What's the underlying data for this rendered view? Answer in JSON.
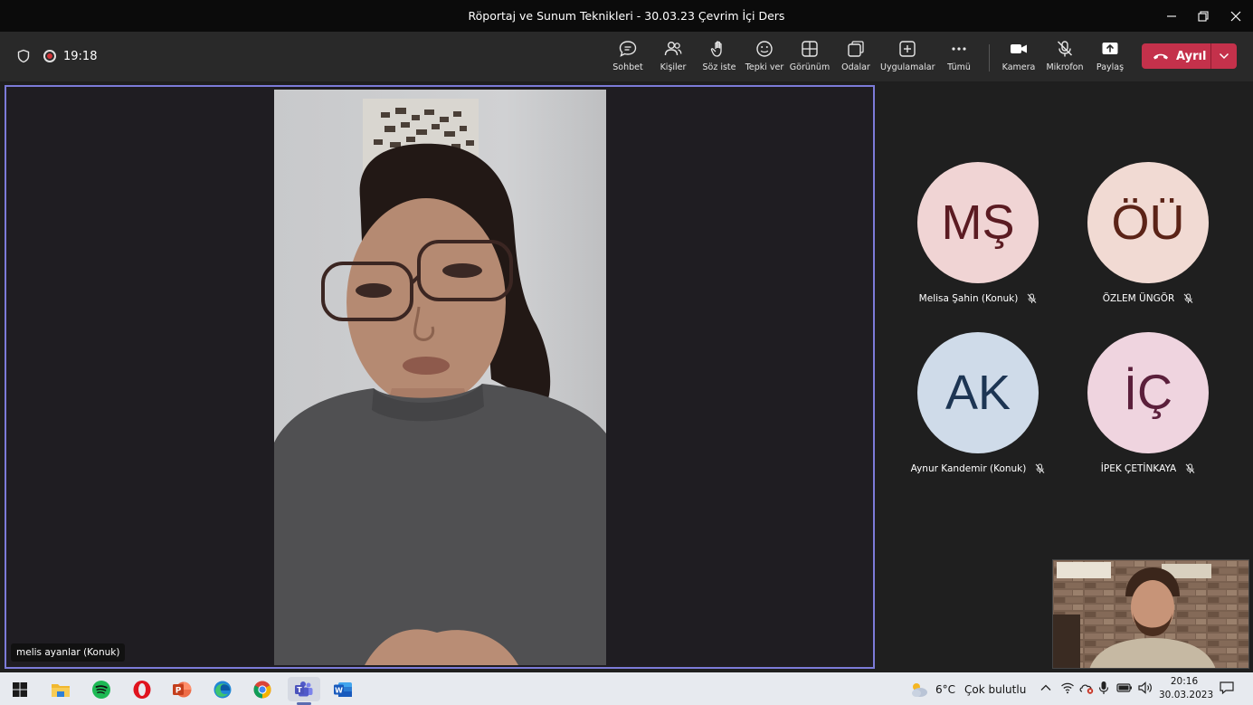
{
  "window": {
    "title": "Röportaj ve Sunum Teknikleri - 30.03.23 Çevrim İçi Ders"
  },
  "toolbar": {
    "meeting_time": "19:18",
    "chat": "Sohbet",
    "people": "Kişiler",
    "raise_hand": "Söz iste",
    "react": "Tepki ver",
    "view": "Görünüm",
    "rooms": "Odalar",
    "apps": "Uygulamalar",
    "more": "Tümü",
    "camera": "Kamera",
    "mic": "Mikrofon",
    "share": "Paylaş",
    "leave": "Ayrıl",
    "leave_color": "#c4314b"
  },
  "stage": {
    "speaker_name": "melis ayanlar (Konuk)",
    "highlight_color": "#7c7bd8"
  },
  "participants": [
    {
      "initials": "MŞ",
      "name": "Melisa Şahin (Konuk)",
      "bg": "#f0d4d4",
      "fg": "#5b1b22"
    },
    {
      "initials": "ÖÜ",
      "name": "ÖZLEM ÜNGÖR",
      "bg": "#f1dad3",
      "fg": "#5b2317"
    },
    {
      "initials": "AK",
      "name": "Aynur Kandemir (Konuk)",
      "bg": "#cfdbe9",
      "fg": "#1d3553"
    },
    {
      "initials": "İÇ",
      "name": "İPEK ÇETİNKAYA",
      "bg": "#efd4df",
      "fg": "#5b1f3b"
    }
  ],
  "taskbar": {
    "temperature": "6°C",
    "weather": "Çok bulutlu",
    "time": "20:16",
    "date": "30.03.2023",
    "apps": [
      "windows-start",
      "file-explorer",
      "spotify",
      "opera",
      "powerpoint",
      "edge",
      "chrome",
      "teams",
      "word"
    ]
  }
}
